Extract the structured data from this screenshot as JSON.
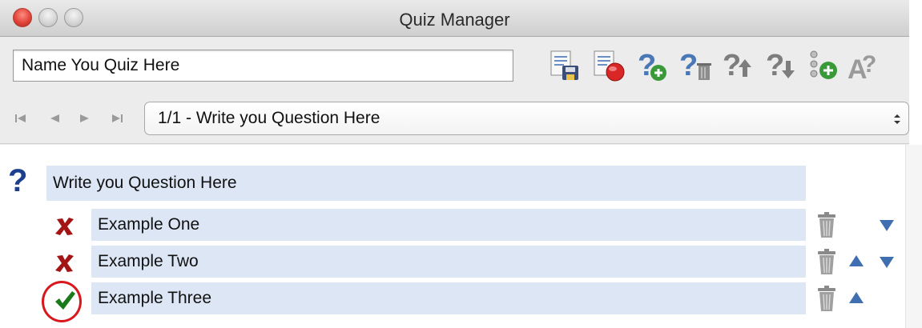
{
  "window": {
    "title": "Quiz Manager"
  },
  "quiz": {
    "name_value": "Name You Quiz Here",
    "toolbar_icons": [
      "save-quiz-icon",
      "delete-quiz-icon",
      "add-question-icon",
      "delete-question-icon",
      "move-question-up-icon",
      "move-question-down-icon",
      "add-answer-icon",
      "answer-settings-icon"
    ]
  },
  "navigation": {
    "icons": [
      "first-icon",
      "previous-icon",
      "next-icon",
      "last-icon"
    ],
    "selected_question": "1/1 - Write you Question Here"
  },
  "question": {
    "text": "Write you Question Here"
  },
  "answers": [
    {
      "text": "Example One",
      "status_icon": "incorrect-x-icon",
      "move_up": false,
      "move_down": true
    },
    {
      "text": "Example Two",
      "status_icon": "incorrect-x-icon",
      "move_up": true,
      "move_down": true
    },
    {
      "text": "Example Three",
      "status_icon": "correct-check-icon",
      "move_up": true,
      "move_down": false
    }
  ],
  "colors": {
    "field_background": "#dce6f5",
    "correct": "#1a7a1a",
    "incorrect": "#a31515",
    "arrow": "#3f6fb0",
    "annotation": "#d8181c"
  },
  "annotation": {
    "highlighted_answer_index": 2
  }
}
